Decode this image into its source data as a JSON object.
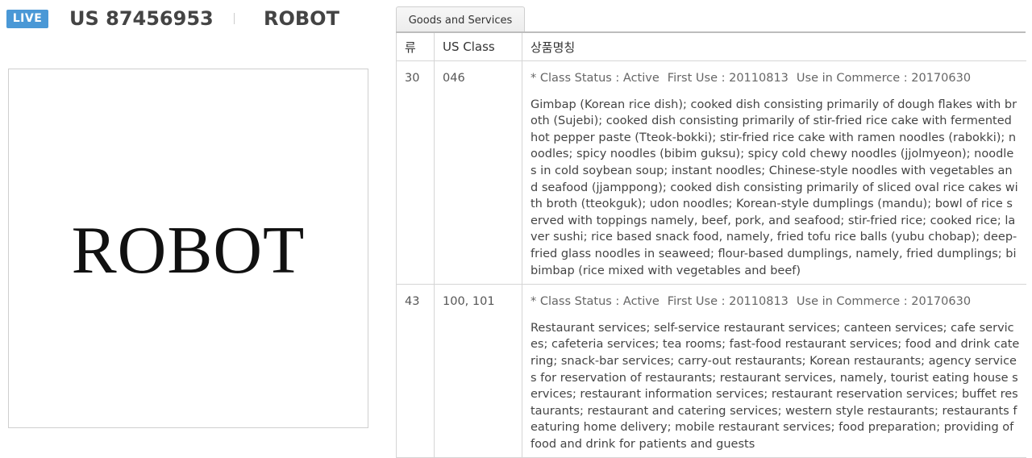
{
  "header": {
    "badge": "LIVE",
    "serial": "US 87456953",
    "mark_name": "ROBOT"
  },
  "mark_image": {
    "word": "ROBOT"
  },
  "tab": {
    "label": "Goods and Services"
  },
  "table": {
    "columns": [
      "류",
      "US Class",
      "상품명칭"
    ],
    "rows": [
      {
        "class": "30",
        "us_class": "046",
        "status": "* Class Status : Active",
        "first_use": "First Use : 20110813",
        "use_in_commerce": "Use in Commerce : 20170630",
        "goods": "Gimbap (Korean rice dish); cooked dish consisting primarily of dough flakes with broth (Sujebi); cooked dish consisting primarily of stir-fried rice cake with fermented hot pepper paste (Tteok-bokki); stir-fried rice cake with ramen noodles (rabokki); noodles; spicy noodles (bibim guksu); spicy cold chewy noodles (jjolmyeon); noodles in cold soybean soup; instant noodles; Chinese-style noodles with vegetables and seafood (jjamppong); cooked dish consisting primarily of sliced oval rice cakes with broth (tteokguk); udon noodles; Korean-style dumplings (mandu); bowl of rice served with toppings namely, beef, pork, and seafood; stir-fried rice; cooked rice; laver sushi; rice based snack food, namely, fried tofu rice balls (yubu chobap); deep-fried glass noodles in seaweed; flour-based dumplings, namely, fried dumplings; bibimbap (rice mixed with vegetables and beef)"
      },
      {
        "class": "43",
        "us_class": "100, 101",
        "status": "* Class Status : Active",
        "first_use": "First Use : 20110813",
        "use_in_commerce": "Use in Commerce : 20170630",
        "goods": "Restaurant services; self-service restaurant services; canteen services; cafe services; cafeteria services; tea rooms; fast-food restaurant services; food and drink catering; snack-bar services; carry-out restaurants; Korean restaurants; agency services for reservation of restaurants; restaurant services, namely, tourist eating house services; restaurant information services; restaurant reservation services; buffet restaurants; restaurant and catering services; western style restaurants; restaurants featuring home delivery; mobile restaurant services; food preparation; providing of food and drink for patients and guests"
      }
    ]
  }
}
